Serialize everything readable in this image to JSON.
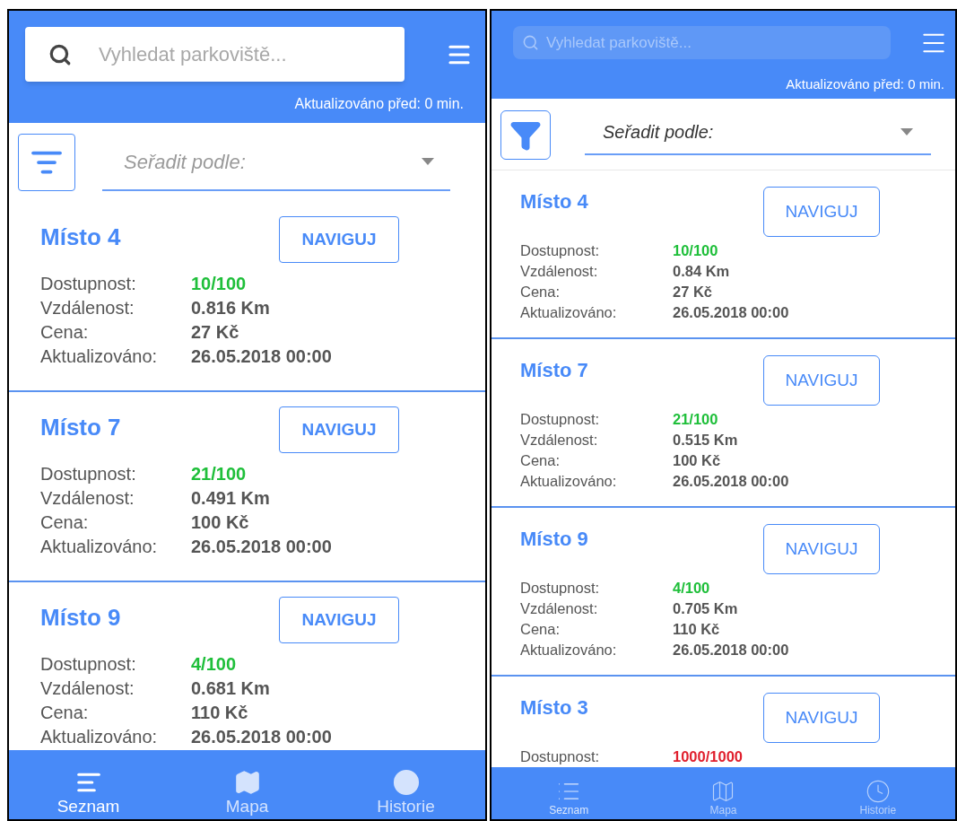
{
  "screens": [
    {
      "kind": "android",
      "search": {
        "placeholder": "Vyhledat parkoviště..."
      },
      "updated": "Aktualizováno před: 0 min.",
      "sort": {
        "placeholder": "Seřadit podle:"
      },
      "places": [
        {
          "title": "Místo 4",
          "button": "NAVIGUJ",
          "color": "#1fbf3a",
          "fields": [
            {
              "label": "Dostupnost:",
              "value": "10/100"
            },
            {
              "label": "Vzdálenost:",
              "value": "0.816 Km"
            },
            {
              "label": "Cena:",
              "value": "27 Kč"
            },
            {
              "label": "Aktualizováno:",
              "value": "26.05.2018 00:00"
            }
          ]
        },
        {
          "title": "Místo 7",
          "button": "NAVIGUJ",
          "color": "#1fbf3a",
          "fields": [
            {
              "label": "Dostupnost:",
              "value": "21/100"
            },
            {
              "label": "Vzdálenost:",
              "value": "0.491 Km"
            },
            {
              "label": "Cena:",
              "value": "100 Kč"
            },
            {
              "label": "Aktualizováno:",
              "value": "26.05.2018 00:00"
            }
          ]
        },
        {
          "title": "Místo 9",
          "button": "NAVIGUJ",
          "color": "#1fbf3a",
          "fields": [
            {
              "label": "Dostupnost:",
              "value": "4/100"
            },
            {
              "label": "Vzdálenost:",
              "value": "0.681 Km"
            },
            {
              "label": "Cena:",
              "value": "110 Kč"
            },
            {
              "label": "Aktualizováno:",
              "value": "26.05.2018 00:00"
            }
          ]
        }
      ],
      "tabs": [
        {
          "label": "Seznam",
          "selected": true
        },
        {
          "label": "Mapa",
          "selected": false
        },
        {
          "label": "Historie",
          "selected": false
        }
      ]
    },
    {
      "kind": "ios",
      "search": {
        "placeholder": "Vyhledat parkoviště..."
      },
      "updated": "Aktualizováno před: 0 min.",
      "sort": {
        "placeholder": "Seřadit podle:"
      },
      "places": [
        {
          "title": "Místo 4",
          "button": "NAVIGUJ",
          "color": "#1fbf3a",
          "fields": [
            {
              "label": "Dostupnost:",
              "value": "10/100"
            },
            {
              "label": "Vzdálenost:",
              "value": "0.84 Km"
            },
            {
              "label": "Cena:",
              "value": "27 Kč"
            },
            {
              "label": "Aktualizováno:",
              "value": "26.05.2018 00:00"
            }
          ]
        },
        {
          "title": "Místo 7",
          "button": "NAVIGUJ",
          "color": "#1fbf3a",
          "fields": [
            {
              "label": "Dostupnost:",
              "value": "21/100"
            },
            {
              "label": "Vzdálenost:",
              "value": "0.515 Km"
            },
            {
              "label": "Cena:",
              "value": "100 Kč"
            },
            {
              "label": "Aktualizováno:",
              "value": "26.05.2018 00:00"
            }
          ]
        },
        {
          "title": "Místo 9",
          "button": "NAVIGUJ",
          "color": "#1fbf3a",
          "fields": [
            {
              "label": "Dostupnost:",
              "value": "4/100"
            },
            {
              "label": "Vzdálenost:",
              "value": "0.705 Km"
            },
            {
              "label": "Cena:",
              "value": "110 Kč"
            },
            {
              "label": "Aktualizováno:",
              "value": "26.05.2018 00:00"
            }
          ]
        },
        {
          "title": "Místo 3",
          "button": "NAVIGUJ",
          "color": "#e0202e",
          "fields": [
            {
              "label": "Dostupnost:",
              "value": "1000/1000"
            }
          ]
        }
      ],
      "tabs": [
        {
          "label": "Seznam",
          "selected": true
        },
        {
          "label": "Mapa",
          "selected": false
        },
        {
          "label": "Historie",
          "selected": false
        }
      ]
    }
  ]
}
